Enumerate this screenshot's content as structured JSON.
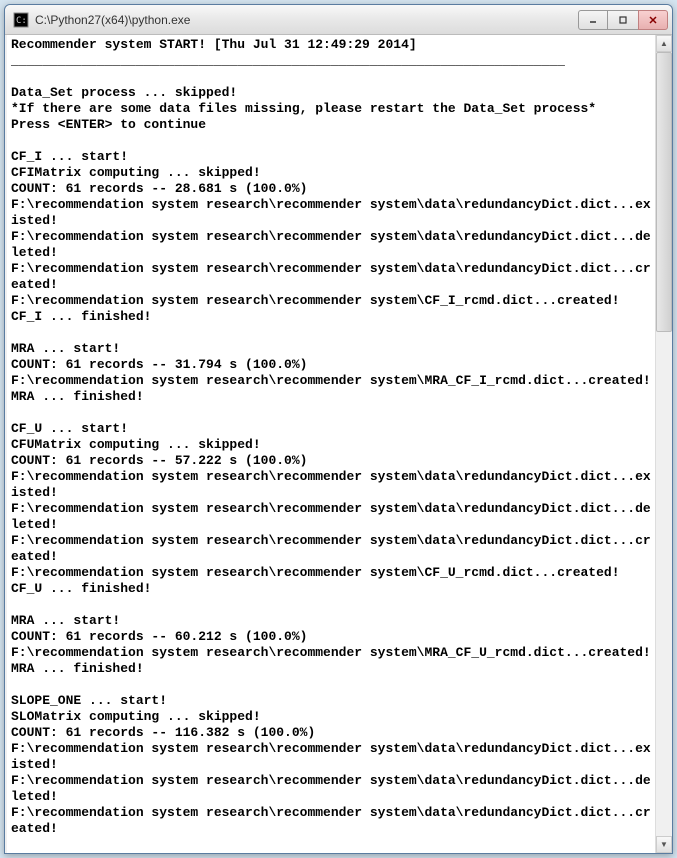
{
  "window": {
    "title": "C:\\Python27(x64)\\python.exe"
  },
  "console_lines": [
    "Recommender system START! [Thu Jul 31 12:49:29 2014]",
    "_______________________________________________________________________",
    "",
    "Data_Set process ... skipped!",
    "*If there are some data files missing, please restart the Data_Set process*",
    "Press <ENTER> to continue",
    "",
    "CF_I ... start!",
    "CFIMatrix computing ... skipped!",
    "COUNT: 61 records -- 28.681 s (100.0%)",
    "F:\\recommendation system research\\recommender system\\data\\redundancyDict.dict...existed!",
    "F:\\recommendation system research\\recommender system\\data\\redundancyDict.dict...deleted!",
    "F:\\recommendation system research\\recommender system\\data\\redundancyDict.dict...created!",
    "F:\\recommendation system research\\recommender system\\CF_I_rcmd.dict...created!",
    "CF_I ... finished!",
    "",
    "MRA ... start!",
    "COUNT: 61 records -- 31.794 s (100.0%)",
    "F:\\recommendation system research\\recommender system\\MRA_CF_I_rcmd.dict...created!",
    "MRA ... finished!",
    "",
    "CF_U ... start!",
    "CFUMatrix computing ... skipped!",
    "COUNT: 61 records -- 57.222 s (100.0%)",
    "F:\\recommendation system research\\recommender system\\data\\redundancyDict.dict...existed!",
    "F:\\recommendation system research\\recommender system\\data\\redundancyDict.dict...deleted!",
    "F:\\recommendation system research\\recommender system\\data\\redundancyDict.dict...created!",
    "F:\\recommendation system research\\recommender system\\CF_U_rcmd.dict...created!",
    "CF_U ... finished!",
    "",
    "MRA ... start!",
    "COUNT: 61 records -- 60.212 s (100.0%)",
    "F:\\recommendation system research\\recommender system\\MRA_CF_U_rcmd.dict...created!",
    "MRA ... finished!",
    "",
    "SLOPE_ONE ... start!",
    "SLOMatrix computing ... skipped!",
    "COUNT: 61 records -- 116.382 s (100.0%)",
    "F:\\recommendation system research\\recommender system\\data\\redundancyDict.dict...existed!",
    "F:\\recommendation system research\\recommender system\\data\\redundancyDict.dict...deleted!",
    "F:\\recommendation system research\\recommender system\\data\\redundancyDict.dict...created!"
  ]
}
